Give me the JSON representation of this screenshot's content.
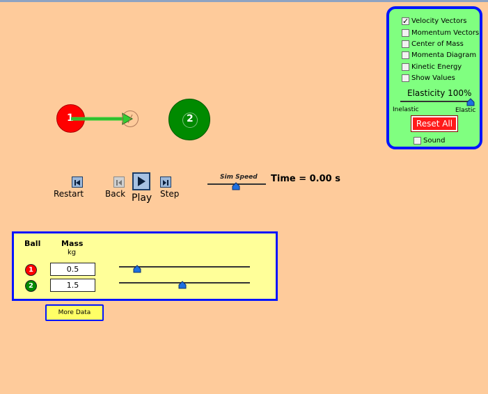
{
  "simulation": {
    "balls": [
      {
        "label": "1",
        "color": "#FF0000"
      },
      {
        "label": "2",
        "color": "#008A00"
      }
    ],
    "velocity_arrow_color": "#33CC33"
  },
  "playback": {
    "restart": "Restart",
    "back": "Back",
    "play": "Play",
    "step": "Step",
    "sim_speed_label": "Sim Speed",
    "time_text": "Time = 0.00 s"
  },
  "control_panel": {
    "checkboxes": [
      {
        "label": "Velocity Vectors",
        "checked": true
      },
      {
        "label": "Momentum Vectors",
        "checked": false
      },
      {
        "label": "Center of Mass",
        "checked": false
      },
      {
        "label": "Momenta Diagram",
        "checked": false
      },
      {
        "label": "Kinetic Energy",
        "checked": false
      },
      {
        "label": "Show Values",
        "checked": false
      }
    ],
    "elasticity_label": "Elasticity 100%",
    "elasticity_value_percent": 100,
    "inelastic_label": "Inelastic",
    "elastic_label": "Elastic",
    "reset_label": "Reset All",
    "sound_label": "Sound",
    "sound_checked": false
  },
  "data_panel": {
    "ball_header": "Ball",
    "mass_header": "Mass",
    "mass_unit": "kg",
    "rows": [
      {
        "ball": "1",
        "mass": "0.5",
        "color": "#FF0000"
      },
      {
        "ball": "2",
        "mass": "1.5",
        "color": "#008A00"
      }
    ],
    "more_data_label": "More Data"
  },
  "colors": {
    "background": "#FECB9B",
    "panel_border": "#0015FF",
    "control_panel_bg": "#80FF80",
    "data_panel_bg": "#FFFF99",
    "slider_thumb": "#1E6FE0"
  }
}
